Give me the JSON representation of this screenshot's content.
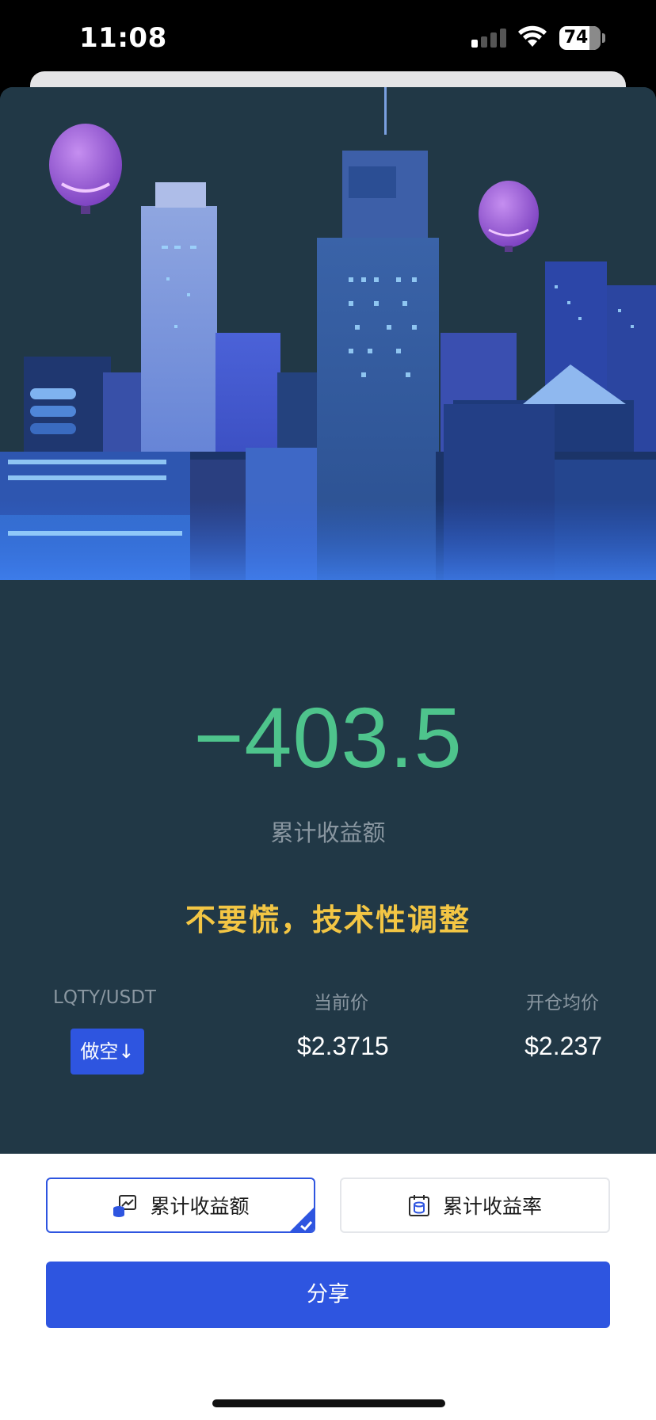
{
  "status_bar": {
    "time": "11:08",
    "battery": "74"
  },
  "card": {
    "pnl_value": "−403.5",
    "pnl_label": "累计收益额",
    "slogan": "不要慌，技术性调整",
    "pair": "LQTY/USDT",
    "direction_badge": "做空↓",
    "current_price_label": "当前价",
    "current_price": "$2.3715",
    "avg_price_label": "开仓均价",
    "avg_price": "$2.237"
  },
  "options": [
    {
      "label": "累计收益额",
      "selected": true
    },
    {
      "label": "累计收益率",
      "selected": false
    }
  ],
  "share_button": "分享",
  "colors": {
    "card_bg": "#213846",
    "profit_green": "#4ec48c",
    "slogan_yellow": "#f3c644",
    "accent_blue": "#2e55e0"
  }
}
